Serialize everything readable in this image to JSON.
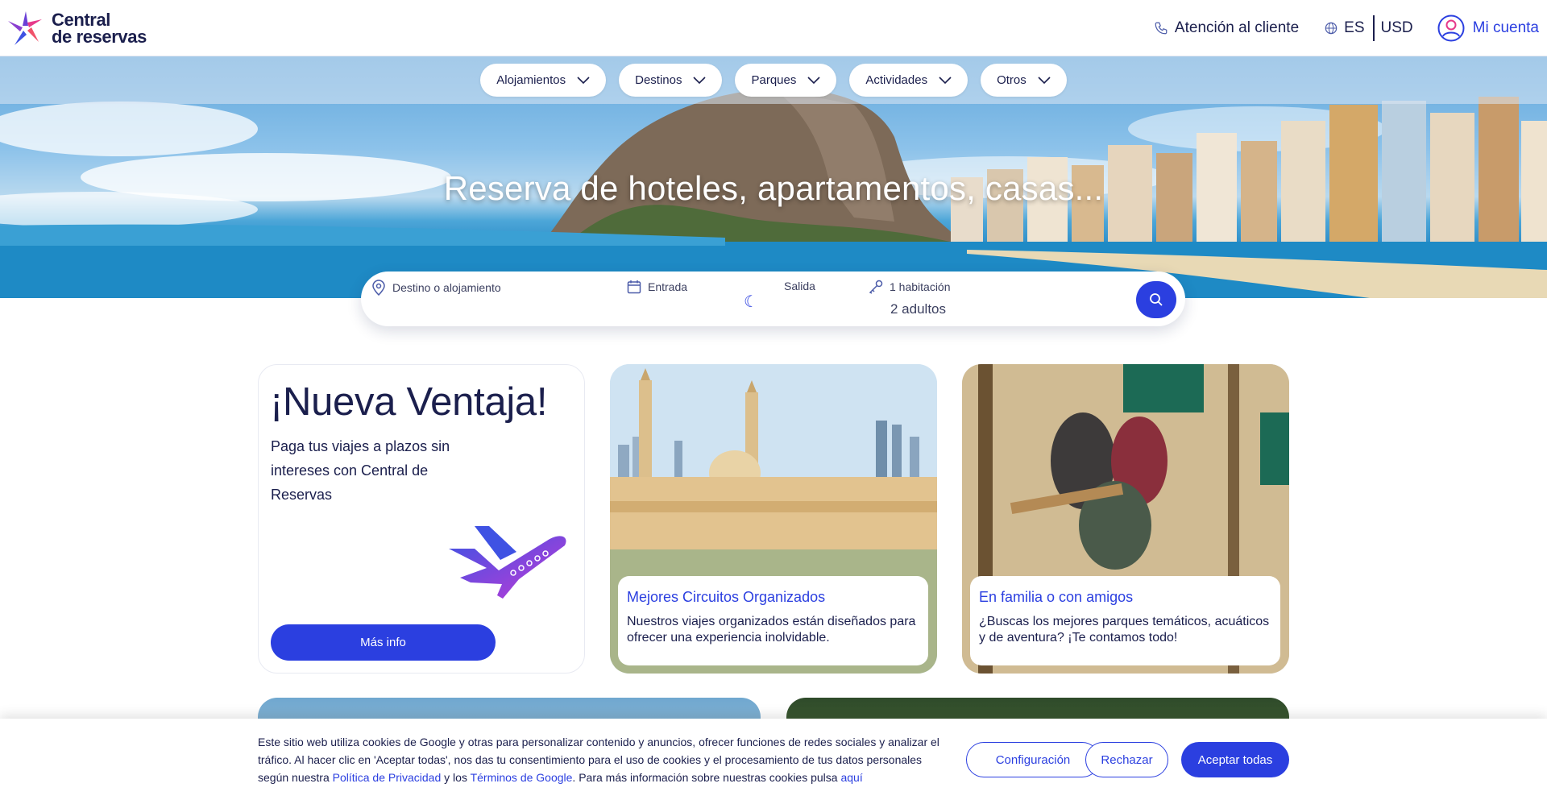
{
  "brand": {
    "name_line1": "Central",
    "name_line2": "de reservas"
  },
  "header": {
    "support_label": "Atención al cliente",
    "language": "ES",
    "currency": "USD",
    "account_label": "Mi cuenta"
  },
  "nav": {
    "items": [
      {
        "label": "Alojamientos"
      },
      {
        "label": "Destinos"
      },
      {
        "label": "Parques"
      },
      {
        "label": "Actividades"
      },
      {
        "label": "Otros"
      }
    ]
  },
  "hero": {
    "title": "Reserva de hoteles, apartamentos, casas..."
  },
  "search": {
    "destination_placeholder": "Destino o alojamiento",
    "checkin_label": "Entrada",
    "checkout_label": "Salida",
    "rooms_label": "1 habitación",
    "guests_value": "2 adultos"
  },
  "promo": {
    "title": "¡Nueva Ventaja!",
    "text": "Paga tus viajes a plazos sin intereses con Central de Reservas",
    "button_label": "Más info"
  },
  "cards": [
    {
      "title": "Mejores Circuitos Organizados",
      "text": "Nuestros viajes organizados están diseñados para ofrecer una experiencia inolvidable."
    },
    {
      "title": "En familia o con amigos",
      "text": "¿Buscas los mejores parques temáticos, acuáticos y de aventura? ¡Te contamos todo!"
    }
  ],
  "cookie": {
    "text_part1": "Este sitio web utiliza cookies de Google y otras para personalizar contenido y anuncios, ofrecer funciones de redes sociales y analizar el tráfico. Al hacer clic en 'Aceptar todas', nos das tu consentimiento para el uso de cookies y el procesamiento de tus datos personales según nuestra ",
    "privacy_link": "Política de Privacidad",
    "text_part2": " y los ",
    "terms_link": "Términos de Google",
    "text_part3": ". Para más información sobre nuestras cookies pulsa ",
    "here_link": "aquí",
    "config_label": "Configuración",
    "reject_label": "Rechazar",
    "accept_label": "Aceptar todas"
  },
  "colors": {
    "primary": "#2b3fe0",
    "text": "#1b1f4d"
  },
  "icons": [
    "logo-star-icon",
    "phone-icon",
    "globe-icon",
    "user-circle-icon",
    "chevron-down-icon",
    "location-pin-icon",
    "calendar-icon",
    "moon-icon",
    "key-icon",
    "search-icon",
    "airplane-icon"
  ]
}
